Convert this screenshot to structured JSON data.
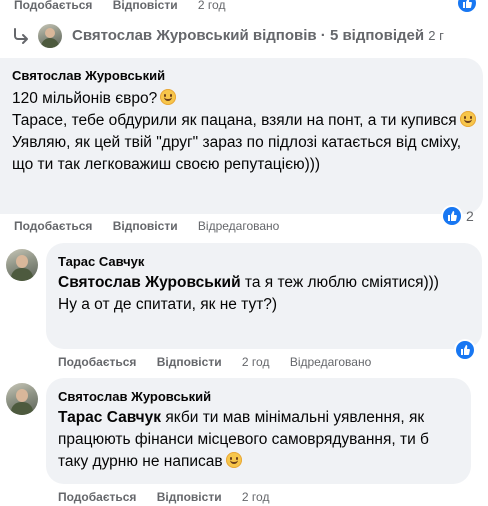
{
  "top_actions": {
    "like": "Подобається",
    "reply": "Відповісти",
    "time": "2 год"
  },
  "reply_summary": {
    "text": "Святослав Журовський відповів · 5 відповідей",
    "time": "2 г"
  },
  "comments": [
    {
      "author": "Святослав Журовський",
      "lines": [
        "120 мільйонів євро?",
        "Тарасе, тебе обдурили як пацана, взяли на понт, а ти купився",
        "Уявляю, як цей твій \"друг\" зараз по підлозі катається від сміху, що ти так легковажиш своєю репутацією)))"
      ],
      "actions": {
        "like": "Подобається",
        "reply": "Відповісти",
        "edited": "Відредаговано"
      },
      "reaction_count": "2"
    },
    {
      "author": "Тарас Савчук",
      "mention": "Святослав Журовський",
      "line1_rest": " та я теж люблю сміятися)))",
      "line2": "Ну а от де спитати, як не тут?)",
      "actions": {
        "like": "Подобається",
        "reply": "Відповісти",
        "time": "2 год",
        "edited": "Відредаговано"
      }
    },
    {
      "author": "Святослав Журовський",
      "mention": "Тарас Савчук",
      "rest": " якби ти мав мінімальні уявлення, як працюють фінанси місцевого самоврядування, ти б таку дурню не написав",
      "actions": {
        "like": "Подобається",
        "reply": "Відповісти",
        "time": "2 год"
      }
    }
  ],
  "colors": {
    "bubble": "#f0f2f5",
    "meta": "#65676b",
    "like_blue": "#1877f2",
    "text": "#050505"
  },
  "icons": [
    "reply-arrow-icon",
    "avatar",
    "emoji-smile-icon",
    "like-reaction-icon"
  ]
}
